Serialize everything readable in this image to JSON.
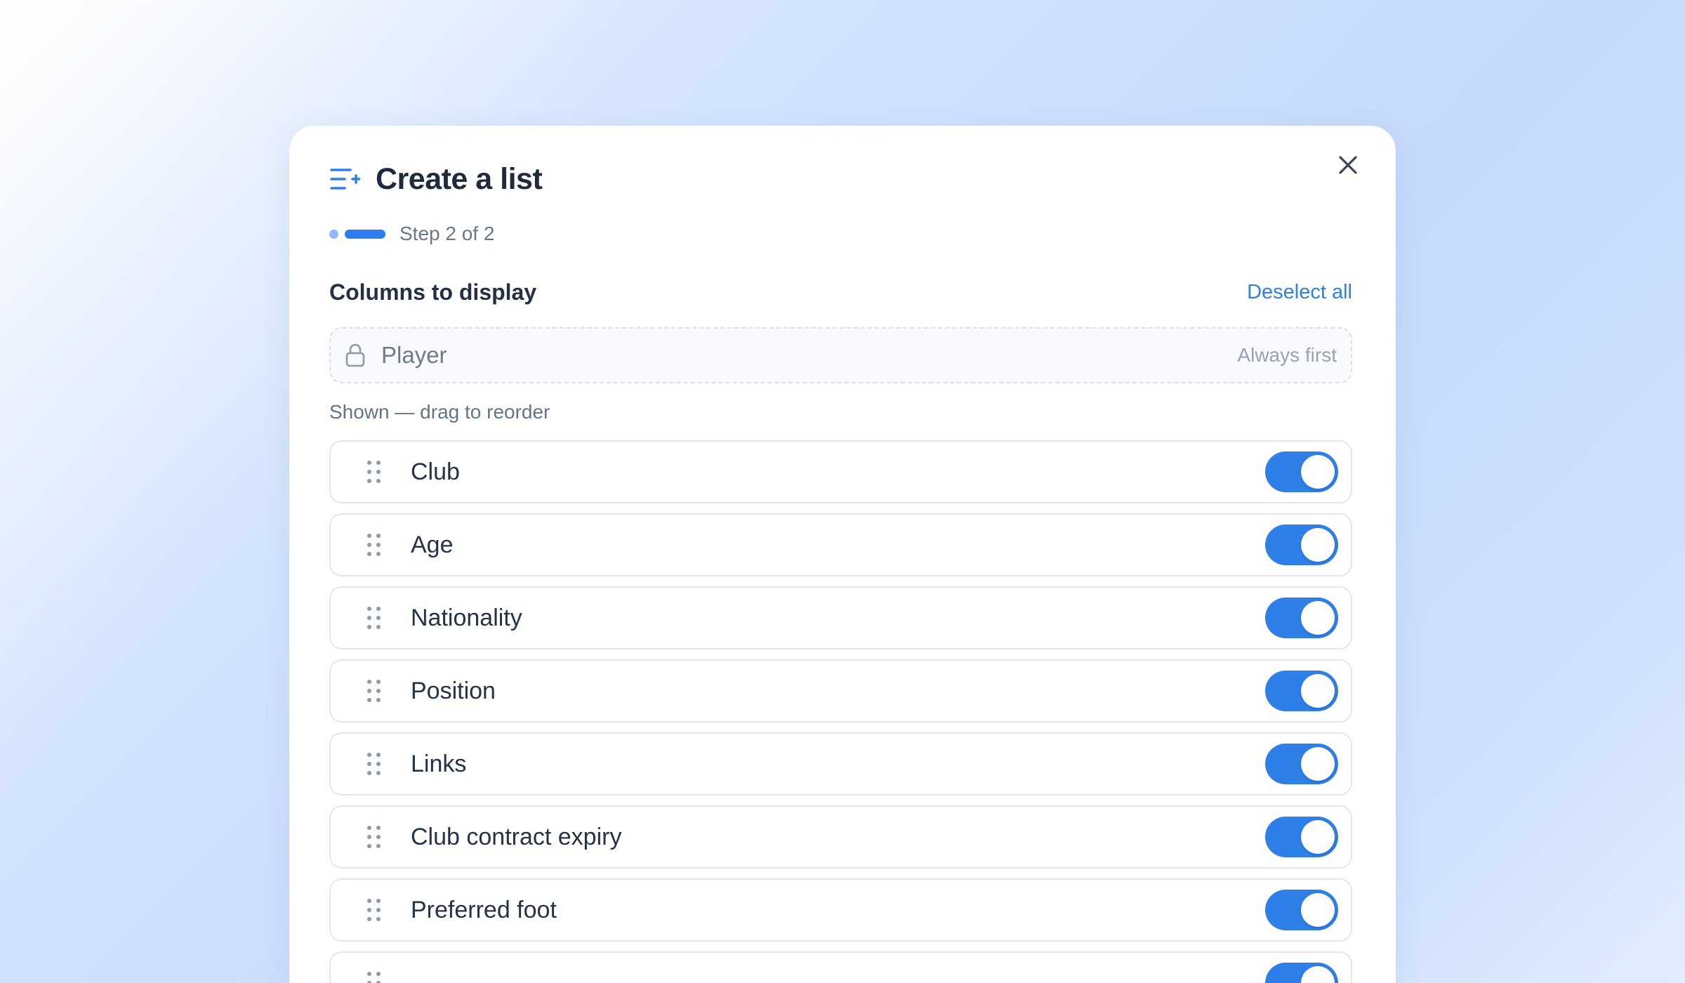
{
  "modal": {
    "title": "Create a list",
    "step_text": "Step 2 of 2",
    "section_title": "Columns to display",
    "deselect_label": "Deselect all",
    "locked_column": {
      "label": "Player",
      "note": "Always first"
    },
    "shown_label": "Shown — drag to reorder",
    "columns": [
      {
        "label": "Club",
        "enabled": true
      },
      {
        "label": "Age",
        "enabled": true
      },
      {
        "label": "Nationality",
        "enabled": true
      },
      {
        "label": "Position",
        "enabled": true
      },
      {
        "label": "Links",
        "enabled": true
      },
      {
        "label": "Club contract expiry",
        "enabled": true
      },
      {
        "label": "Preferred foot",
        "enabled": true
      },
      {
        "label": "",
        "enabled": true
      }
    ]
  },
  "icons": {
    "header": "list-add-icon",
    "close": "close-icon",
    "lock": "lock-icon",
    "drag": "drag-handle-icon"
  },
  "colors": {
    "accent": "#2f7fe9",
    "title": "#1f2a3c",
    "muted": "#6b7789"
  }
}
